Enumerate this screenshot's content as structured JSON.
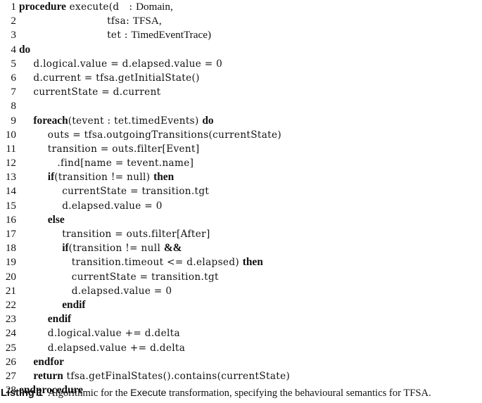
{
  "listing": {
    "label": "Listing 1",
    "caption_before": "Algorithmic for the ",
    "caption_mono": "Execute",
    "caption_after": " transformation, specifying the behavioural semantics for TFSA.",
    "lines": [
      {
        "n": "1",
        "indent": 0,
        "text": "procedure execute(d   : Domain,",
        "kw": "procedure",
        "rm_tail": "Domain,"
      },
      {
        "n": "2",
        "indent": 9.2,
        "text": "tfsa: TFSA,",
        "kw": "",
        "rm_tail": "TFSA,"
      },
      {
        "n": "3",
        "indent": 9.2,
        "text": "tet : TimedEventTrace)",
        "kw": "",
        "rm_tail": "TimedEventTrace)"
      },
      {
        "n": "4",
        "indent": 0,
        "text": "do",
        "kw": "do",
        "rm_tail": ""
      },
      {
        "n": "5",
        "indent": 1.5,
        "text": "d.logical.value = d.elapsed.value = 0",
        "kw": "",
        "rm_tail": ""
      },
      {
        "n": "6",
        "indent": 1.5,
        "text": "d.current = tfsa.getInitialState()",
        "kw": "",
        "rm_tail": ""
      },
      {
        "n": "7",
        "indent": 1.5,
        "text": "currentState = d.current",
        "kw": "",
        "rm_tail": ""
      },
      {
        "n": "8",
        "indent": 0,
        "text": "",
        "kw": "",
        "rm_tail": ""
      },
      {
        "n": "9",
        "indent": 1.5,
        "text": "foreach(tevent : tet.timedEvents) do",
        "kw": "foreach",
        "rm_tail": "do"
      },
      {
        "n": "10",
        "indent": 3.0,
        "text": "outs = tfsa.outgoingTransitions(currentState)",
        "kw": "",
        "rm_tail": ""
      },
      {
        "n": "11",
        "indent": 3.0,
        "text": "transition = outs.filter[Event]",
        "kw": "",
        "rm_tail": "Event"
      },
      {
        "n": "12",
        "indent": 4.0,
        "text": ".find[name = tevent.name]",
        "kw": "",
        "rm_tail": ""
      },
      {
        "n": "13",
        "indent": 3.0,
        "text": "if(transition != null) then",
        "kw": "if",
        "rm_tail": "then"
      },
      {
        "n": "14",
        "indent": 4.5,
        "text": "currentState = transition.tgt",
        "kw": "",
        "rm_tail": ""
      },
      {
        "n": "15",
        "indent": 4.5,
        "text": "d.elapsed.value = 0",
        "kw": "",
        "rm_tail": ""
      },
      {
        "n": "16",
        "indent": 3.0,
        "text": "else",
        "kw": "else",
        "rm_tail": ""
      },
      {
        "n": "17",
        "indent": 4.5,
        "text": "transition = outs.filter[After]",
        "kw": "",
        "rm_tail": "After"
      },
      {
        "n": "18",
        "indent": 4.5,
        "text": "if(transition != null &&",
        "kw": "if",
        "rm_tail": "&&"
      },
      {
        "n": "19",
        "indent": 5.5,
        "text": "transition.timeout <= d.elapsed) then",
        "kw": "",
        "rm_tail": "then"
      },
      {
        "n": "20",
        "indent": 5.5,
        "text": "currentState = transition.tgt",
        "kw": "",
        "rm_tail": ""
      },
      {
        "n": "21",
        "indent": 5.5,
        "text": "d.elapsed.value = 0",
        "kw": "",
        "rm_tail": ""
      },
      {
        "n": "22",
        "indent": 4.5,
        "text": "endif",
        "kw": "endif",
        "rm_tail": ""
      },
      {
        "n": "23",
        "indent": 3.0,
        "text": "endif",
        "kw": "endif",
        "rm_tail": ""
      },
      {
        "n": "24",
        "indent": 3.0,
        "text": "d.logical.value += d.delta",
        "kw": "",
        "rm_tail": ""
      },
      {
        "n": "25",
        "indent": 3.0,
        "text": "d.elapsed.value += d.delta",
        "kw": "",
        "rm_tail": ""
      },
      {
        "n": "26",
        "indent": 1.5,
        "text": "endfor",
        "kw": "endfor",
        "rm_tail": ""
      },
      {
        "n": "27",
        "indent": 1.5,
        "text": "return tfsa.getFinalStates().contains(currentState)",
        "kw": "return",
        "rm_tail": ""
      },
      {
        "n": "28",
        "indent": 0,
        "text": "endprocedure",
        "kw": "endprocedure",
        "rm_tail": ""
      }
    ]
  },
  "colors": {
    "text": "#111111",
    "background": "#ffffff"
  }
}
